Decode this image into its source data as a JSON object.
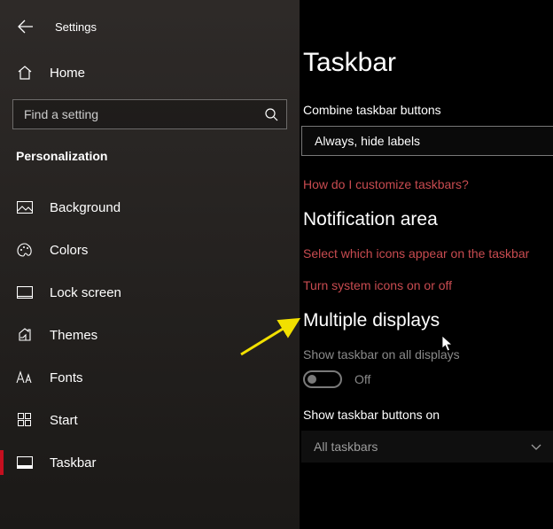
{
  "app": {
    "title": "Settings"
  },
  "sidebar": {
    "home": "Home",
    "search_placeholder": "Find a setting",
    "section": "Personalization",
    "items": [
      {
        "label": "Background",
        "icon": "picture-icon"
      },
      {
        "label": "Colors",
        "icon": "palette-icon"
      },
      {
        "label": "Lock screen",
        "icon": "lockscreen-icon"
      },
      {
        "label": "Themes",
        "icon": "themes-icon"
      },
      {
        "label": "Fonts",
        "icon": "fonts-icon"
      },
      {
        "label": "Start",
        "icon": "start-icon"
      },
      {
        "label": "Taskbar",
        "icon": "taskbar-icon"
      }
    ]
  },
  "main": {
    "title": "Taskbar",
    "combine": {
      "label": "Combine taskbar buttons",
      "value": "Always, hide labels"
    },
    "link_customize": "How do I customize taskbars?",
    "notification": {
      "heading": "Notification area",
      "link_select_icons": "Select which icons appear on the taskbar",
      "link_system_icons": "Turn system icons on or off"
    },
    "multiple": {
      "heading": "Multiple displays",
      "show_all_label": "Show taskbar on all displays",
      "toggle_state": "Off",
      "show_buttons_label": "Show taskbar buttons on",
      "show_buttons_value": "All taskbars"
    }
  }
}
